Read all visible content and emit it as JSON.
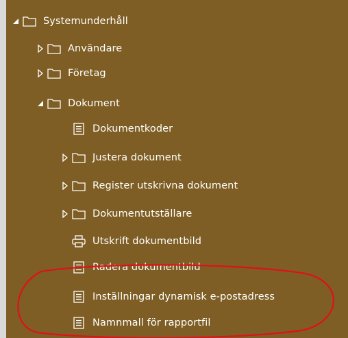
{
  "tree": {
    "root": {
      "label": "Systemunderhåll",
      "icon": "folder-icon",
      "expanded": true
    },
    "items": [
      {
        "label": "Användare",
        "icon": "folder-icon",
        "expanded": false
      },
      {
        "label": "Företag",
        "icon": "folder-icon",
        "expanded": false
      },
      {
        "label": "Dokument",
        "icon": "folder-icon",
        "expanded": true
      },
      {
        "label": "Dokumentkoder",
        "icon": "document-icon"
      },
      {
        "label": "Justera dokument",
        "icon": "folder-icon",
        "expanded": false
      },
      {
        "label": "Register utskrivna dokument",
        "icon": "folder-icon",
        "expanded": false
      },
      {
        "label": "Dokumentutställare",
        "icon": "folder-icon",
        "expanded": false
      },
      {
        "label": "Utskrift dokumentbild",
        "icon": "printer-icon"
      },
      {
        "label": "Radera dokumentbild",
        "icon": "document-icon"
      },
      {
        "label": "Inställningar dynamisk e-postadress",
        "icon": "document-icon"
      },
      {
        "label": "Namnmall för rapportfil",
        "icon": "document-icon"
      }
    ]
  },
  "colors": {
    "panel_background": "#7e5e24",
    "text": "#ffffff",
    "annotation_ellipse": "#e0101a"
  }
}
